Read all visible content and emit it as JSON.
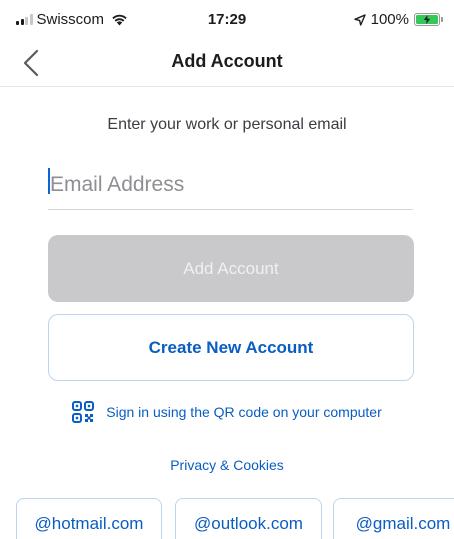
{
  "status_bar": {
    "carrier": "Swisscom",
    "time": "17:29",
    "battery": "100%",
    "battery_level": 1.0,
    "signal_bars": 2,
    "icons": [
      "signal-icon",
      "wifi-icon",
      "location-arrow-icon",
      "battery-charging-icon"
    ]
  },
  "nav": {
    "title": "Add Account",
    "back_icon": "chevron-left-icon"
  },
  "form": {
    "prompt": "Enter your work or personal email",
    "email_placeholder": "Email Address",
    "email_value": "",
    "add_account_label": "Add Account",
    "create_account_label": "Create New Account"
  },
  "links": {
    "qr_label": "Sign in using the QR code on your computer",
    "qr_icon": "qr-code-icon",
    "privacy_label": "Privacy & Cookies"
  },
  "domains": [
    "@hotmail.com",
    "@outlook.com",
    "@gmail.com"
  ],
  "colors": {
    "accent": "#0a5dc2",
    "disabled_button": "#c9c9cc",
    "battery_green": "#34c759"
  }
}
